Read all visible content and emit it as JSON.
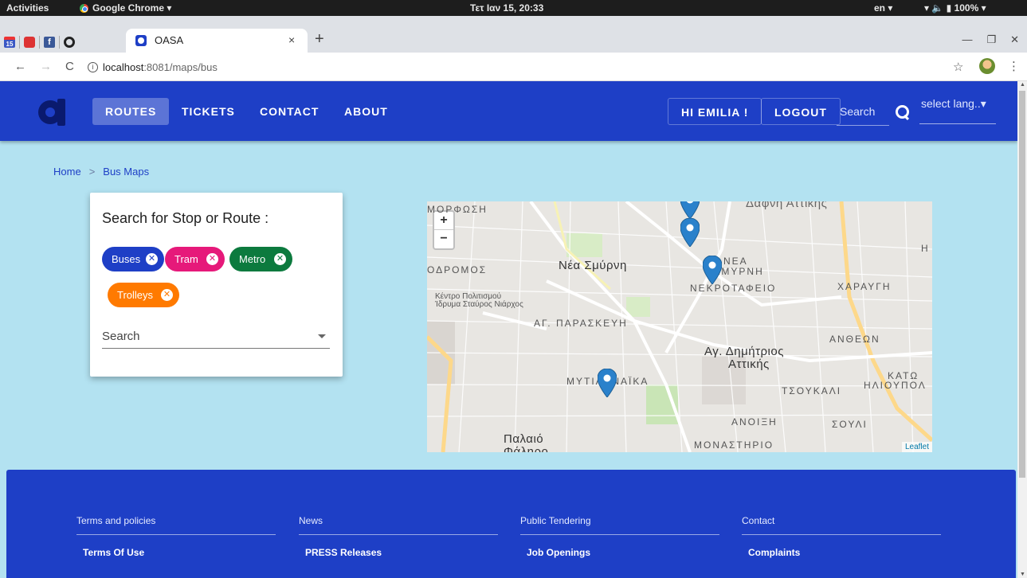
{
  "os_bar": {
    "activities": "Activities",
    "app_name": "Google Chrome ▾",
    "clock": "Τετ Ιαν 15, 20:33",
    "lang": "en ▾",
    "system": "▾ 🔈 ▮ 100% ▾"
  },
  "browser": {
    "pinned_tabs": [
      "15",
      "",
      "f",
      ""
    ],
    "active_tab_title": "OASA",
    "tab_close": "×",
    "new_tab": "+",
    "url_host": "localhost",
    "url_path": ":8081/maps/bus",
    "window_controls": [
      "—",
      "❐",
      "✕"
    ]
  },
  "navbar": {
    "items": [
      "ROUTES",
      "TICKETS",
      "CONTACT",
      "ABOUT"
    ],
    "active": "ROUTES",
    "greeting": "HI EMILIA !",
    "logout": "LOGOUT",
    "search_placeholder": "Search",
    "lang_select": "select lang..▾"
  },
  "breadcrumb": {
    "home": "Home",
    "separator": ">",
    "current": "Bus Maps"
  },
  "search_card": {
    "title": "Search for Stop or Route :",
    "chips": [
      {
        "label": "Buses",
        "color": "#1e3fc6"
      },
      {
        "label": "Tram",
        "color": "#e6197a"
      },
      {
        "label": "Metro",
        "color": "#0c7a3e"
      },
      {
        "label": "Trolleys",
        "color": "#ff7a00"
      }
    ],
    "chip_remove": "✕",
    "search_label": "Search"
  },
  "map": {
    "zoom_in": "+",
    "zoom_out": "−",
    "attribution": "Leaflet",
    "labels": [
      "ΜΟΡΦΩΣΗ",
      "Δαφνη Αττικης",
      "ΟΔΡΟΜΟΣ",
      "Νέα Σμύρνη",
      "ΝΕΑ",
      "ΣΜΥΡΝΗ",
      "ΝΕΚΡΟΤΑΦΕΙΟ",
      "ΧΑΡΑΥΓΗ",
      "Κέντρο Πολιτισμού",
      "Ίδρυμα Σταύρος Νιάρχος",
      "ΑΓ. ΠΑΡΑΣΚΕΥΗ",
      "ΑΝΘΕΩΝ",
      "Αγ. Δημήτριος",
      "Αττικής",
      "ΚΑΤΩ",
      "ΗΛΙΟΥΠΟΛ",
      "ΜΥΤΙΛΗΝΑΪΚΑ",
      "ΤΣΟΥΚΑΛΙ",
      "ΑΝΟΙΞΗ",
      "ΣΟΥΛΙ",
      "Παλαιό",
      "Φάληρο",
      "ΜΟΝΑΣΤΗΡΙΟ",
      "H"
    ],
    "marker_color": "#2a81cb"
  },
  "footer": {
    "columns": [
      {
        "heading": "Terms and policies",
        "link": "Terms Of Use"
      },
      {
        "heading": "News",
        "link": "PRESS Releases"
      },
      {
        "heading": "Public Tendering",
        "link": "Job Openings"
      },
      {
        "heading": "Contact",
        "link": "Complaints"
      }
    ]
  }
}
